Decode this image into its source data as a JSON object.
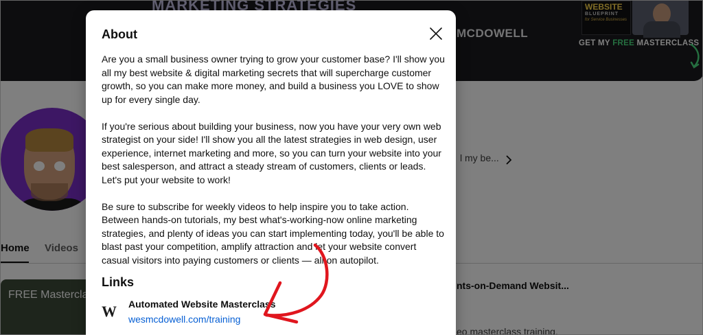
{
  "banner": {
    "headline": "MARKETING STRATEGIES",
    "brand": "MCDOWELL",
    "book_title": "WEBSITE",
    "book_subtitle": "BLUEPRINT",
    "book_tagline": "for Service Businesses",
    "cta_prefix": "GET MY ",
    "cta_accent": "FREE",
    "cta_suffix": " MASTERCLASS"
  },
  "channel": {
    "description_peek": "l my be..."
  },
  "tabs": [
    {
      "label": "Home"
    },
    {
      "label": "Videos"
    }
  ],
  "videos": {
    "thumb_title": "FREE Masterclass",
    "title_peek": "nts-on-Demand Websit...",
    "desc_peek": "eo masterclass training."
  },
  "modal": {
    "title": "About",
    "paragraphs": [
      "Are you a small business owner trying to grow your customer base? I'll show you all my best website & digital marketing secrets that will supercharge customer growth, so you can make more money, and build a business you LOVE to show up for every single day.",
      "If you're serious about building your business, now you have your very own web strategist on your side! I'll show you all the latest strategies in web design, user experience, internet marketing and more, so you can turn your website into your best salesperson, and attract a steady stream of customers, clients or leads. Let's put your website to work!",
      "Be sure to subscribe for weekly videos to help inspire you to take action. Between hands-on tutorials, my best what's-working-now online marketing strategies, and plenty of ideas you can start implementing today, you'll be able to blast past your competition, amplify attraction and let your website convert casual visitors into paying customers or clients — all on autopilot."
    ],
    "links_heading": "Links",
    "link": {
      "favicon": "W",
      "title": "Automated Website Masterclass",
      "url": "wesmcdowell.com/training"
    }
  },
  "colors": {
    "banner_bg": "#1b1b1f",
    "avatar_bg": "#7a2fc8",
    "link_blue": "#065fd4",
    "annotation_red": "#e0161e",
    "cta_green": "#4ade80"
  },
  "icons": {
    "close": "close-icon",
    "chevron": "chevron-right-icon",
    "arrow": "curved-arrow-icon"
  }
}
